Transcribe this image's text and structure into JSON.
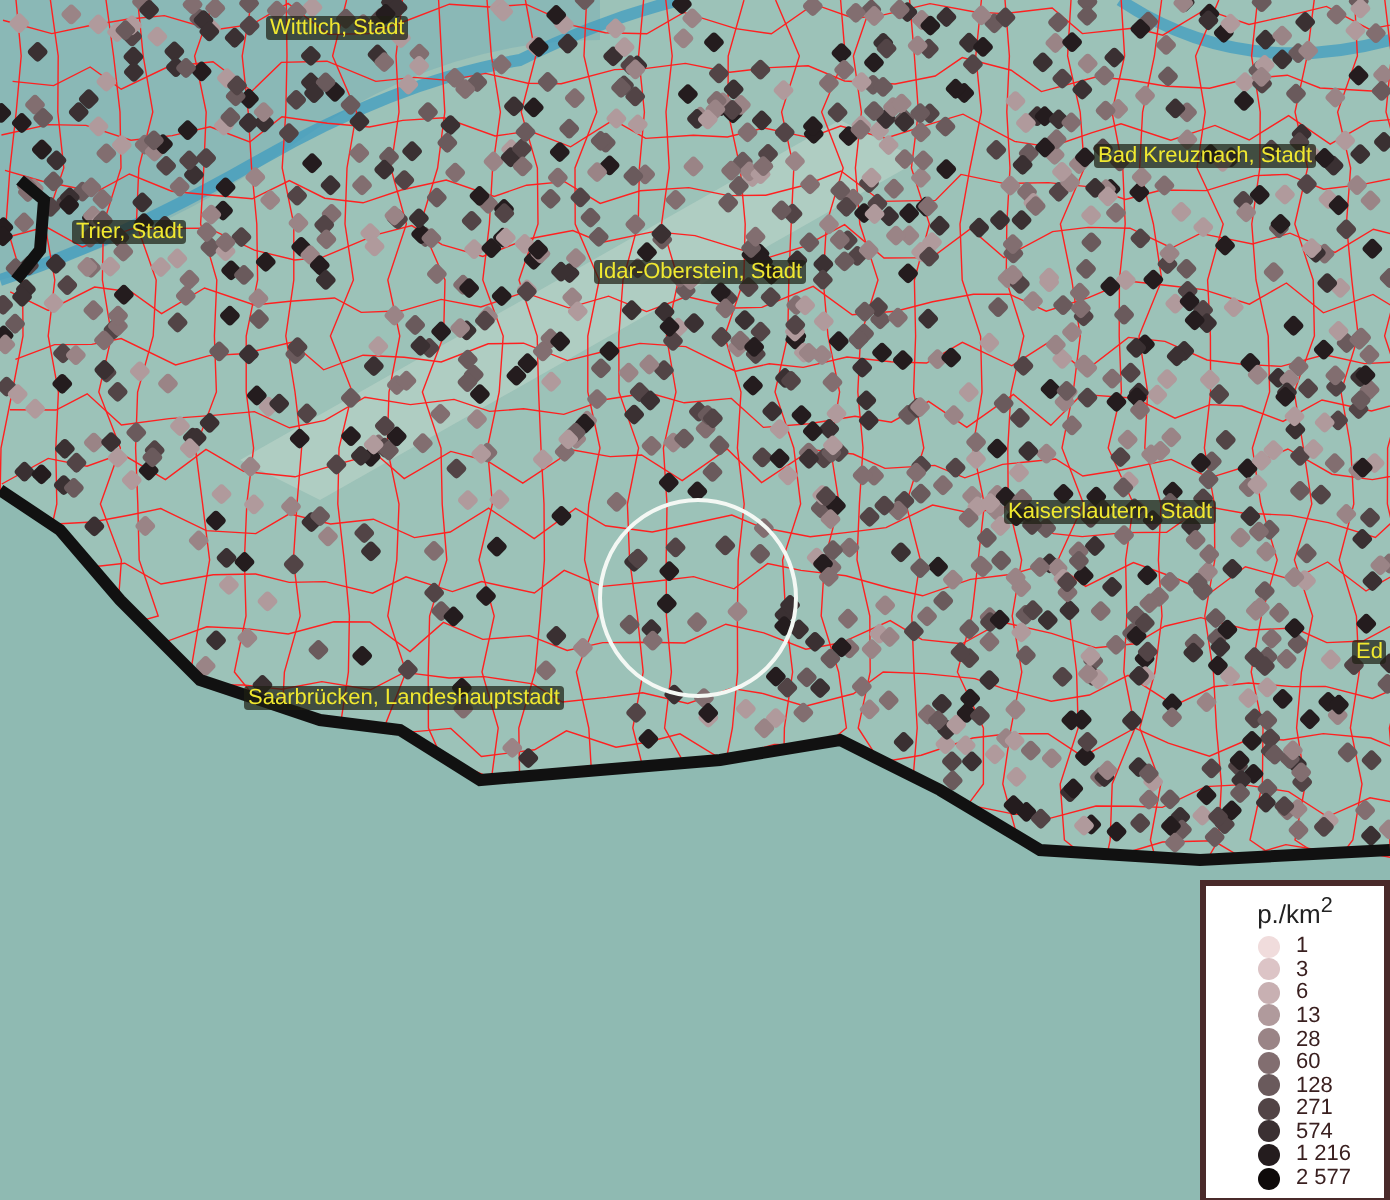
{
  "map": {
    "place_labels": [
      {
        "text": "Wittlich, Stadt"
      },
      {
        "text": "Trier, Stadt"
      },
      {
        "text": "Idar-Oberstein, Stadt"
      },
      {
        "text": "Bad Kreuznach, Stadt"
      },
      {
        "text": "Kaiserslautern, Stadt"
      },
      {
        "text": "Saarbrücken, Landeshauptstadt"
      },
      {
        "text": "Ed"
      }
    ]
  },
  "legend": {
    "title": "p./km$^{2}$",
    "items": [
      {
        "label": "1",
        "color": "#f0dcdc"
      },
      {
        "label": "3",
        "color": "#dcc4c6"
      },
      {
        "label": "6",
        "color": "#c8b0b2"
      },
      {
        "label": "13",
        "color": "#b09a9c"
      },
      {
        "label": "28",
        "color": "#9a8486"
      },
      {
        "label": "60",
        "color": "#826e70"
      },
      {
        "label": "128",
        "color": "#6a5a5c"
      },
      {
        "label": "271",
        "color": "#524446"
      },
      {
        "label": "574",
        "color": "#3a3032"
      },
      {
        "label": "1 216",
        "color": "#241c1e"
      },
      {
        "label": "2 577",
        "color": "#0e0a0a"
      }
    ]
  }
}
